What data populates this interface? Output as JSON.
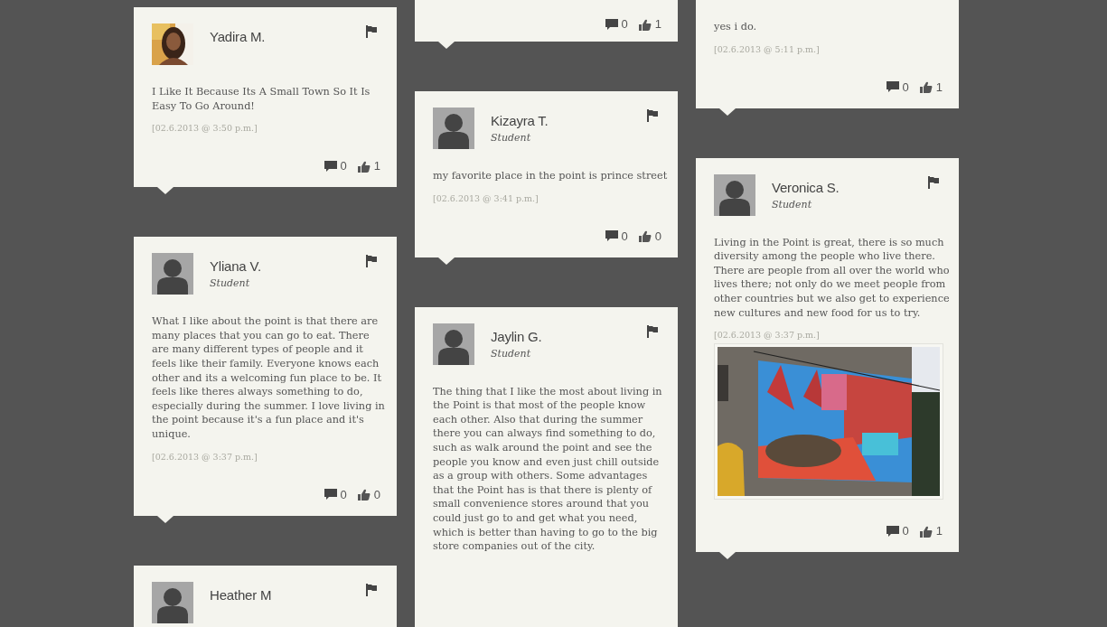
{
  "columns": [
    {
      "cards": [
        {
          "name": "Yadira M.",
          "text": "I Like It Because Its A Small Town So It Is Easy To Go Around!",
          "time": "[02.6.2013 @ 3:50 p.m.]",
          "comments": "0",
          "likes": "1"
        },
        {
          "name": "Yliana V.",
          "role": "Student",
          "avatar": {
            "kind": "placeholder"
          },
          "text": "What I like about the point is that there are many places that you can go to eat. There are many different types of people and it feels like their family. Everyone knows each other and its a welcoming fun place to be. It feels like theres always something to do, especially during the summer. I love living in the point because it's a fun place and it's unique.",
          "time": "[02.6.2013 @ 3:37 p.m.]",
          "comments": "0",
          "likes": "0"
        },
        {
          "name": "Heather M",
          "avatar": {
            "kind": "placeholder"
          }
        }
      ]
    },
    {
      "cards": [
        {
          "comments": "0",
          "likes": "1"
        },
        {
          "name": "Kizayra T.",
          "role": "Student",
          "avatar": {
            "kind": "placeholder"
          },
          "text": "my favorite place in the point is prince street",
          "time": "[02.6.2013 @ 3:41 p.m.]",
          "comments": "0",
          "likes": "0"
        },
        {
          "name": "Jaylin G.",
          "role": "Student",
          "avatar": {
            "kind": "placeholder"
          },
          "text": "The thing that I like the most about living in the Point is that most of the people know each other. Also that during the summer there you can always find something to do, such as walk around the point and see the people you know and even just chill outside as a group with others. Some advantages that the Point has is that there is plenty of small convenience stores around that you could just go to and get what you need, which is better than having to go to the big store companies out of the city."
        }
      ]
    },
    {
      "cards": [
        {
          "text": "yes i do.",
          "time": "[02.6.2013 @ 5:11 p.m.]",
          "comments": "0",
          "likes": "1"
        },
        {
          "name": "Veronica S.",
          "role": "Student",
          "avatar": {
            "kind": "placeholder"
          },
          "text": "Living in the Point is great, there is so much diversity among the people who live there. There are people from all over the world who lives there; not only do we meet people from other countries but we also get to experience new cultures and new food for us to try.",
          "time": "[02.6.2013 @ 3:37 p.m.]",
          "comments": "0",
          "likes": "1"
        }
      ]
    }
  ]
}
